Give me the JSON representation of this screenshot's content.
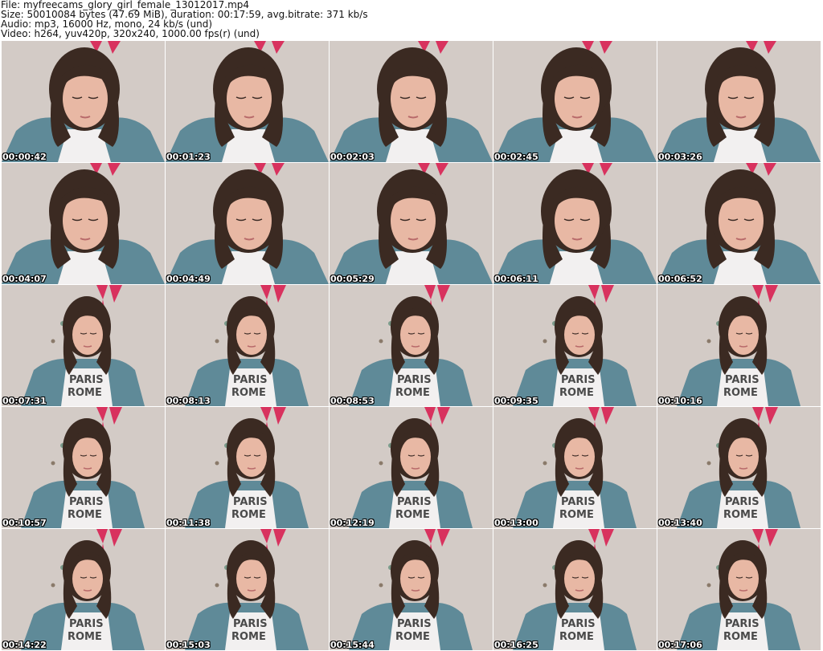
{
  "header": {
    "file": "File: myfreecams_glory_girl_female_13012017.mp4",
    "size": "Size: 50010084 bytes (47.69 MiB), duration: 00:17:59, avg.bitrate: 371 kb/s",
    "audio": "Audio: mp3, 16000 Hz, mono, 24 kb/s (und)",
    "video": "Video: h264, yuv420p, 320x240, 1000.00 fps(r) (und)"
  },
  "thumbnails": [
    {
      "time": "00:00:42",
      "scene": "close"
    },
    {
      "time": "00:01:23",
      "scene": "close"
    },
    {
      "time": "00:02:03",
      "scene": "close"
    },
    {
      "time": "00:02:45",
      "scene": "close"
    },
    {
      "time": "00:03:26",
      "scene": "close"
    },
    {
      "time": "00:04:07",
      "scene": "close"
    },
    {
      "time": "00:04:49",
      "scene": "close"
    },
    {
      "time": "00:05:29",
      "scene": "close"
    },
    {
      "time": "00:06:11",
      "scene": "close"
    },
    {
      "time": "00:06:52",
      "scene": "close"
    },
    {
      "time": "00:07:31",
      "scene": "wide"
    },
    {
      "time": "00:08:13",
      "scene": "wide"
    },
    {
      "time": "00:08:53",
      "scene": "wide"
    },
    {
      "time": "00:09:35",
      "scene": "wide"
    },
    {
      "time": "00:10:16",
      "scene": "wide"
    },
    {
      "time": "00:10:57",
      "scene": "wide"
    },
    {
      "time": "00:11:38",
      "scene": "wide"
    },
    {
      "time": "00:12:19",
      "scene": "wide"
    },
    {
      "time": "00:13:00",
      "scene": "wide"
    },
    {
      "time": "00:13:40",
      "scene": "wide"
    },
    {
      "time": "00:14:22",
      "scene": "wide"
    },
    {
      "time": "00:15:03",
      "scene": "wide"
    },
    {
      "time": "00:15:44",
      "scene": "wide"
    },
    {
      "time": "00:16:25",
      "scene": "wide"
    },
    {
      "time": "00:17:06",
      "scene": "wide"
    }
  ],
  "colors": {
    "wall": "#d3cbc6",
    "ribbon": "#d8325e",
    "hair": "#3b2a22",
    "skin": "#e8b8a4",
    "cardigan": "#5f8a98",
    "shirt": "#f2f0f0"
  }
}
